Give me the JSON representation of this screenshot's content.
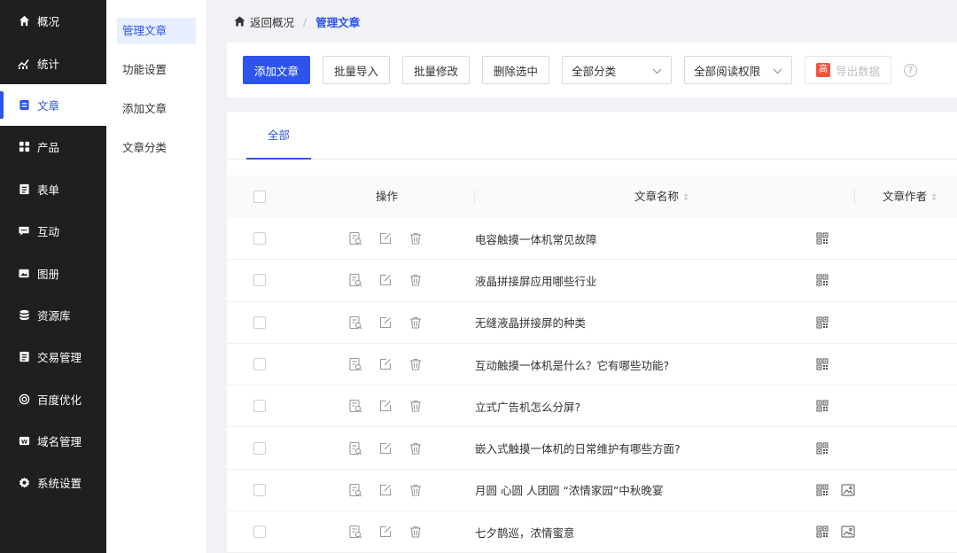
{
  "sidebar": {
    "items": [
      {
        "label": "概况",
        "icon": "home-icon"
      },
      {
        "label": "统计",
        "icon": "stats-icon"
      },
      {
        "label": "文章",
        "icon": "article-icon"
      },
      {
        "label": "产品",
        "icon": "product-icon"
      },
      {
        "label": "表单",
        "icon": "form-icon"
      },
      {
        "label": "互动",
        "icon": "chat-icon"
      },
      {
        "label": "图册",
        "icon": "album-icon"
      },
      {
        "label": "资源库",
        "icon": "database-icon"
      },
      {
        "label": "交易管理",
        "icon": "trade-icon"
      },
      {
        "label": "百度优化",
        "icon": "seo-icon"
      },
      {
        "label": "域名管理",
        "icon": "domain-icon"
      },
      {
        "label": "系统设置",
        "icon": "gear-icon"
      }
    ],
    "active_index": 2
  },
  "submenu": {
    "items": [
      "管理文章",
      "功能设置",
      "添加文章",
      "文章分类"
    ]
  },
  "breadcrumb": {
    "back": "返回概况",
    "separator": "/",
    "current": "管理文章"
  },
  "toolbar": {
    "add": "添加文章",
    "import": "批量导入",
    "batch_edit": "批量修改",
    "delete": "删除选中",
    "category_select": "全部分类",
    "permission_select": "全部阅读权限",
    "export_badge": "高",
    "export": "导出数据",
    "help": "?"
  },
  "tabs": {
    "all": "全部"
  },
  "table": {
    "headers": {
      "ops": "操作",
      "name": "文章名称",
      "author": "文章作者"
    },
    "rows": [
      {
        "title": "电容触摸一体机常见故障",
        "has_image": false
      },
      {
        "title": "液晶拼接屏应用哪些行业",
        "has_image": false
      },
      {
        "title": "无缝液晶拼接屏的种类",
        "has_image": false
      },
      {
        "title": "互动触摸一体机是什么？它有哪些功能?",
        "has_image": false
      },
      {
        "title": "立式广告机怎么分屏?",
        "has_image": false
      },
      {
        "title": "嵌入式触摸一体机的日常维护有哪些方面?",
        "has_image": false
      },
      {
        "title": "月圆 心圆 人团圆 “浓情家园”中秋晚宴",
        "has_image": true
      },
      {
        "title": "七夕鹊巡，浓情蜜意",
        "has_image": true
      }
    ]
  },
  "colors": {
    "accent": "#2f54eb",
    "sidebar_bg": "#1f1f1f",
    "badge": "#f5533d"
  }
}
